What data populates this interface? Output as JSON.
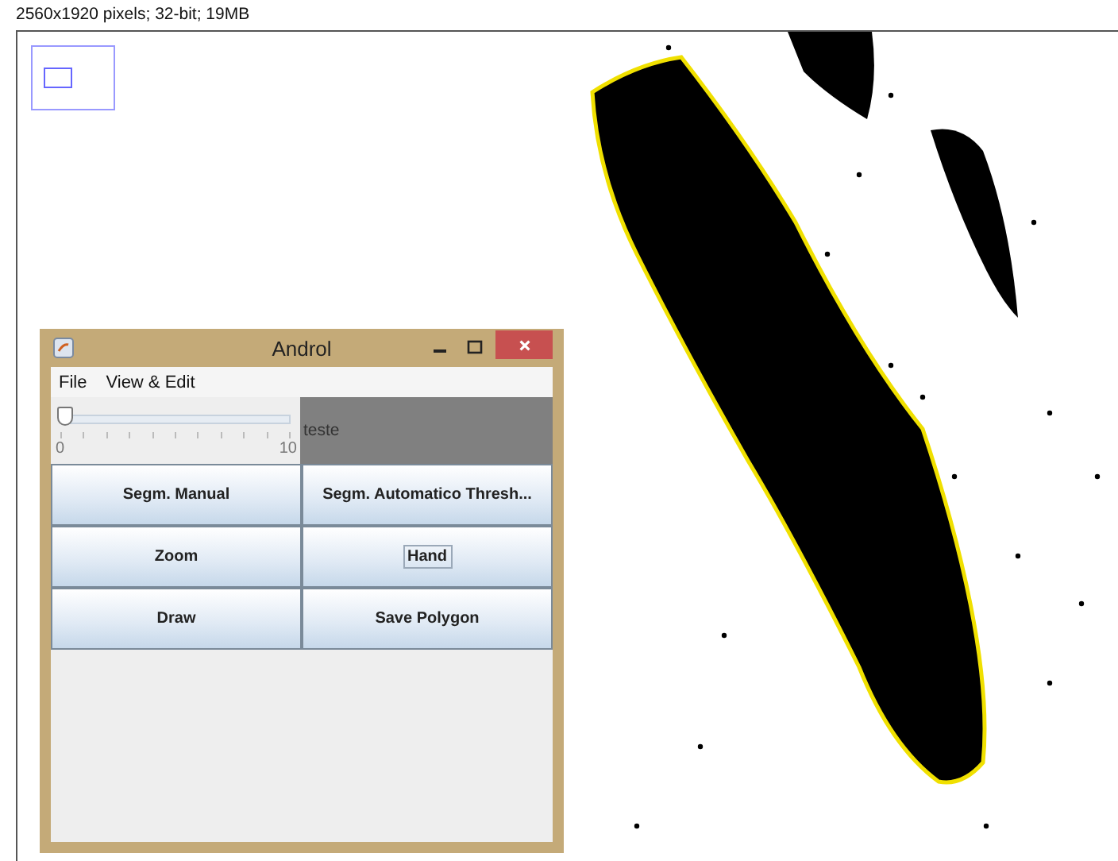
{
  "status_text": "2560x1920 pixels; 32-bit; 19MB",
  "window": {
    "title": "Androl",
    "menus": [
      {
        "label": "File"
      },
      {
        "label": "View & Edit"
      }
    ],
    "slider": {
      "level": 0,
      "min_label": "0",
      "max_label": "10"
    },
    "panel_label": "teste",
    "buttons": [
      {
        "label": "Segm. Manual",
        "focused": false
      },
      {
        "label": "Segm. Automatico Thresh...",
        "focused": false
      },
      {
        "label": "Zoom",
        "focused": false
      },
      {
        "label": "Hand",
        "focused": true
      },
      {
        "label": "Draw",
        "focused": false
      },
      {
        "label": "Save Polygon",
        "focused": false
      }
    ]
  }
}
